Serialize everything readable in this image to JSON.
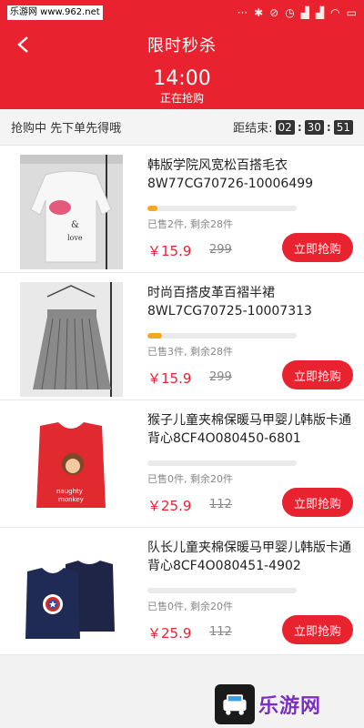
{
  "status_bar": {
    "watermark": "乐游网 www.962.net",
    "icons": [
      "dots-icon",
      "bluetooth-icon",
      "mute-icon",
      "alarm-icon",
      "signal-icon",
      "signal-icon",
      "wifi-icon",
      "battery-icon"
    ]
  },
  "header": {
    "title": "限时秒杀",
    "time": "14:00",
    "status": "正在抢购"
  },
  "countdown": {
    "left_text": "抢购中 先下单先得哦",
    "label": "距结束:",
    "hours": "02",
    "minutes": "30",
    "seconds": "51"
  },
  "colors": {
    "brand": "#e8232f",
    "progress": "#f5a623"
  },
  "items": [
    {
      "name": "韩版学院风宽松百搭毛衣8W77CG70726-10006499",
      "sold_text": "已售2件, 剩余28件",
      "progress": 0.07,
      "price": "￥15.9",
      "original_price": "299",
      "button": "立即抢购"
    },
    {
      "name": "时尚百搭皮革百褶半裙8WL7CG70725-10007313",
      "sold_text": "已售3件, 剩余28件",
      "progress": 0.1,
      "price": "￥15.9",
      "original_price": "299",
      "button": "立即抢购"
    },
    {
      "name": "猴子儿童夹棉保暖马甲婴儿韩版卡通背心8CF4O080450-6801",
      "sold_text": "已售0件, 剩余20件",
      "progress": 0,
      "price": "￥25.9",
      "original_price": "112",
      "button": "立即抢购"
    },
    {
      "name": "队长儿童夹棉保暖马甲婴儿韩版卡通背心8CF4O080451-4902",
      "sold_text": "已售0件, 剩余20件",
      "progress": 0,
      "price": "￥25.9",
      "original_price": "112",
      "button": "立即抢购"
    }
  ],
  "footer_logo": {
    "text": "乐游网"
  }
}
